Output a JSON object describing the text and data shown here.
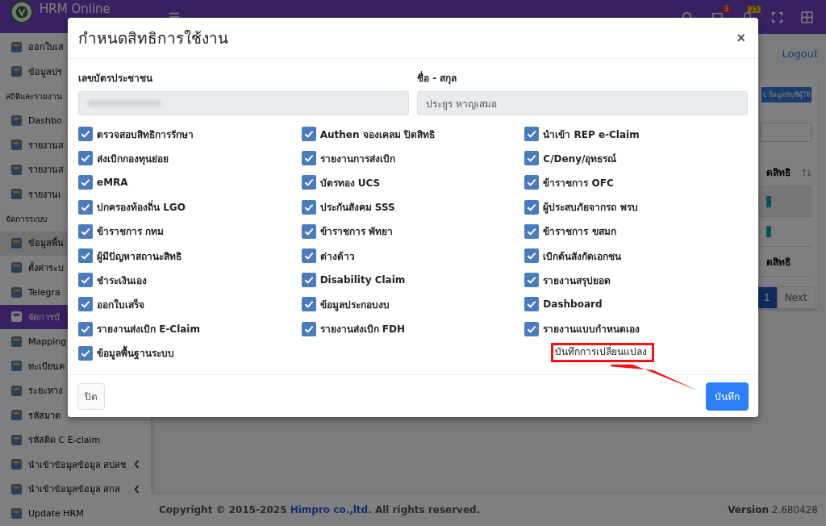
{
  "app": {
    "brand": "HRM Online",
    "logout": "Logout",
    "badges": [
      {
        "kind": "chat",
        "count": "3"
      },
      {
        "kind": "bell",
        "count": "15"
      }
    ]
  },
  "sidebar": {
    "items": [
      {
        "kind": "item",
        "label": "ออกใบเส",
        "selected": false,
        "expanded": false
      },
      {
        "kind": "item",
        "label": "ข้อมูลปร",
        "selected": false,
        "expanded": false
      },
      {
        "kind": "section",
        "label": "สถิติและรายงาน"
      },
      {
        "kind": "item",
        "label": "Dashbo",
        "selected": false,
        "expanded": false
      },
      {
        "kind": "item",
        "label": "รายงานส",
        "selected": false,
        "expanded": false
      },
      {
        "kind": "item",
        "label": "รายงานส",
        "selected": false,
        "expanded": false
      },
      {
        "kind": "item",
        "label": "รายงานเ",
        "selected": false,
        "expanded": false
      },
      {
        "kind": "section",
        "label": "จัดการระบบ"
      },
      {
        "kind": "item",
        "label": "ข้อมูลพื้น",
        "selected": false,
        "expanded": true
      },
      {
        "kind": "item",
        "label": "ตั้งค่าระบ",
        "selected": false,
        "expanded": false
      },
      {
        "kind": "item",
        "label": "Telegra",
        "selected": false,
        "expanded": false
      },
      {
        "kind": "item",
        "label": "จัดการบั",
        "selected": true,
        "expanded": false
      },
      {
        "kind": "item",
        "label": "Mapping",
        "selected": false,
        "expanded": false
      },
      {
        "kind": "item",
        "label": "ทะเบียนค",
        "selected": false,
        "expanded": false
      },
      {
        "kind": "item",
        "label": "ระยะทาง",
        "selected": false,
        "expanded": false
      },
      {
        "kind": "item",
        "label": "รหัสมาต",
        "selected": false,
        "expanded": false
      },
      {
        "kind": "item",
        "label": "รหัสติด C E-claim",
        "selected": false,
        "expanded": false,
        "submenu": false
      },
      {
        "kind": "item",
        "label": "นำเข้าข้อมูลข้อมูล สปสช",
        "selected": false,
        "expanded": false,
        "submenu": true
      },
      {
        "kind": "item",
        "label": "นำเข้าข้อมูลข้อมูล สกส",
        "selected": false,
        "expanded": false,
        "submenu": true
      },
      {
        "kind": "item",
        "label": "Update HRM",
        "selected": false,
        "expanded": false,
        "submenu": false
      }
    ]
  },
  "card": {
    "sync_button": "c ข้อมูลบัญชีผู้ใช้",
    "column_header": "ดสิทธิ",
    "row_text": "ดสิทธิ",
    "pages": [
      {
        "label": "1",
        "selected": true
      },
      {
        "label": "Next",
        "selected": false
      }
    ]
  },
  "footer": {
    "copyright_before": "Copyright © 2015-2025",
    "company": "Himpro co.,ltd.",
    "copyright_after": "All rights reserved.",
    "version": "**Version** 2.680428"
  },
  "modal": {
    "title": "กำหนดสิทธิการใช้งาน",
    "close": "×",
    "fields": [
      {
        "label": "เลขบัตรประชาชน",
        "value_blurred": true
      },
      {
        "label": "ชื่อ - สกุล",
        "value_blurred": false,
        "value": "ประยูร หาญเสมอ"
      }
    ],
    "permissions": [
      {
        "label": "ตรวจสอบสิทธิการรักษา",
        "checked": true
      },
      {
        "label": "Authen จองเคลม ปิดสิทธิ",
        "checked": true
      },
      {
        "label": "นำเข้า REP e-Claim",
        "checked": true
      },
      {
        "label": "ส่งเบิกกองทุนย่อย",
        "checked": true
      },
      {
        "label": "รายงานการส่งเบิก",
        "checked": true
      },
      {
        "label": "C/Deny/อุทธรณ์",
        "checked": true
      },
      {
        "label": "eMRA",
        "checked": true
      },
      {
        "label": "บัตรทอง UCS",
        "checked": true
      },
      {
        "label": "ข้าราชการ OFC",
        "checked": true
      },
      {
        "label": "ปกครองท้องถิ่น LGO",
        "checked": true
      },
      {
        "label": "ประกันสังคม SSS",
        "checked": true
      },
      {
        "label": "ผู้ประสบภัยจากรถ พรบ",
        "checked": true
      },
      {
        "label": "ข้าราชการ กทม",
        "checked": true
      },
      {
        "label": "ข้าราชการ พัทยา",
        "checked": true
      },
      {
        "label": "ข้าราชการ ขสมก",
        "checked": true
      },
      {
        "label": "ผู้มีปัญหาสถานะสิทธิ",
        "checked": true
      },
      {
        "label": "ต่างด้าว",
        "checked": true
      },
      {
        "label": "เบิกต้นสังกัดเอกชน",
        "checked": true
      },
      {
        "label": "ชำระเงินเอง",
        "checked": true
      },
      {
        "label": "Disability Claim",
        "checked": true
      },
      {
        "label": "รายงานสรุปยอด",
        "checked": true
      },
      {
        "label": "ออกใบเสร็จ",
        "checked": true
      },
      {
        "label": "ข้อมูลประกอบงบ",
        "checked": true
      },
      {
        "label": "Dashboard",
        "checked": true
      },
      {
        "label": "รายงานส่งเบิก E-Claim",
        "checked": true
      },
      {
        "label": "รายงานส่งเบิก FDH",
        "checked": true
      },
      {
        "label": "รายงานแบบกำหนดเอง",
        "checked": true
      },
      {
        "label": "ข้อมูลพื้นฐานระบบ",
        "checked": true
      }
    ],
    "annotation": "บันทึกการเปลี่ยนแปลง",
    "buttons": [
      {
        "kind": "secondary",
        "label": "ปิด"
      },
      {
        "kind": "primary",
        "label": "บันทึก"
      }
    ]
  }
}
